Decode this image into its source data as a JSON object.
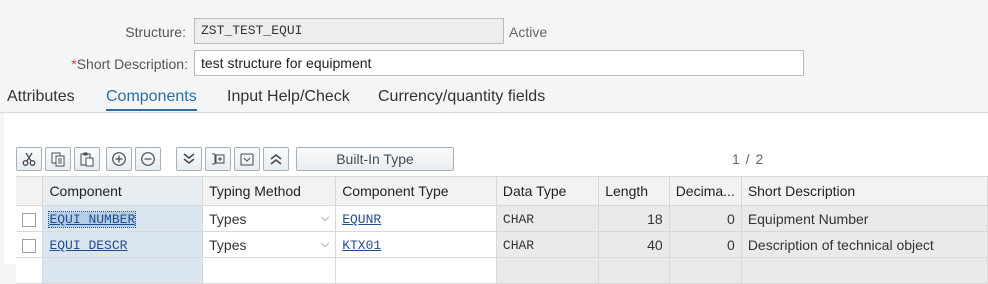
{
  "header": {
    "structure_label": "Structure:",
    "structure_value": "ZST_TEST_EQUI",
    "status": "Active",
    "short_desc_required": "*",
    "short_desc_label": "Short Description:",
    "short_desc_value": "test structure for equipment"
  },
  "tabs": [
    {
      "label": "Attributes"
    },
    {
      "label": "Components"
    },
    {
      "label": "Input Help/Check"
    },
    {
      "label": "Currency/quantity fields"
    }
  ],
  "toolbar": {
    "builtin_type_label": "Built-In Type",
    "pager": "1 / 2"
  },
  "grid": {
    "columns": [
      "Component",
      "Typing Method",
      "Component Type",
      "Data Type",
      "Length",
      "Decima...",
      "Short Description"
    ],
    "rows": [
      {
        "component": "EQUI_NUMBER",
        "typing": "Types",
        "comp_type": "EQUNR",
        "data_type": "CHAR",
        "length": "18",
        "decimals": "0",
        "desc": "Equipment Number"
      },
      {
        "component": "EQUI_DESCR",
        "typing": "Types",
        "comp_type": "KTX01",
        "data_type": "CHAR",
        "length": "40",
        "decimals": "0",
        "desc": "Description of technical object"
      }
    ]
  },
  "icons": [
    "scissors-icon",
    "copy-icon",
    "paste-icon",
    "insert-row-icon",
    "delete-row-icon",
    "expand-all-icon",
    "insert-include-icon",
    "expand-include-icon",
    "collapse-all-icon",
    "chevron-down-icon"
  ]
}
